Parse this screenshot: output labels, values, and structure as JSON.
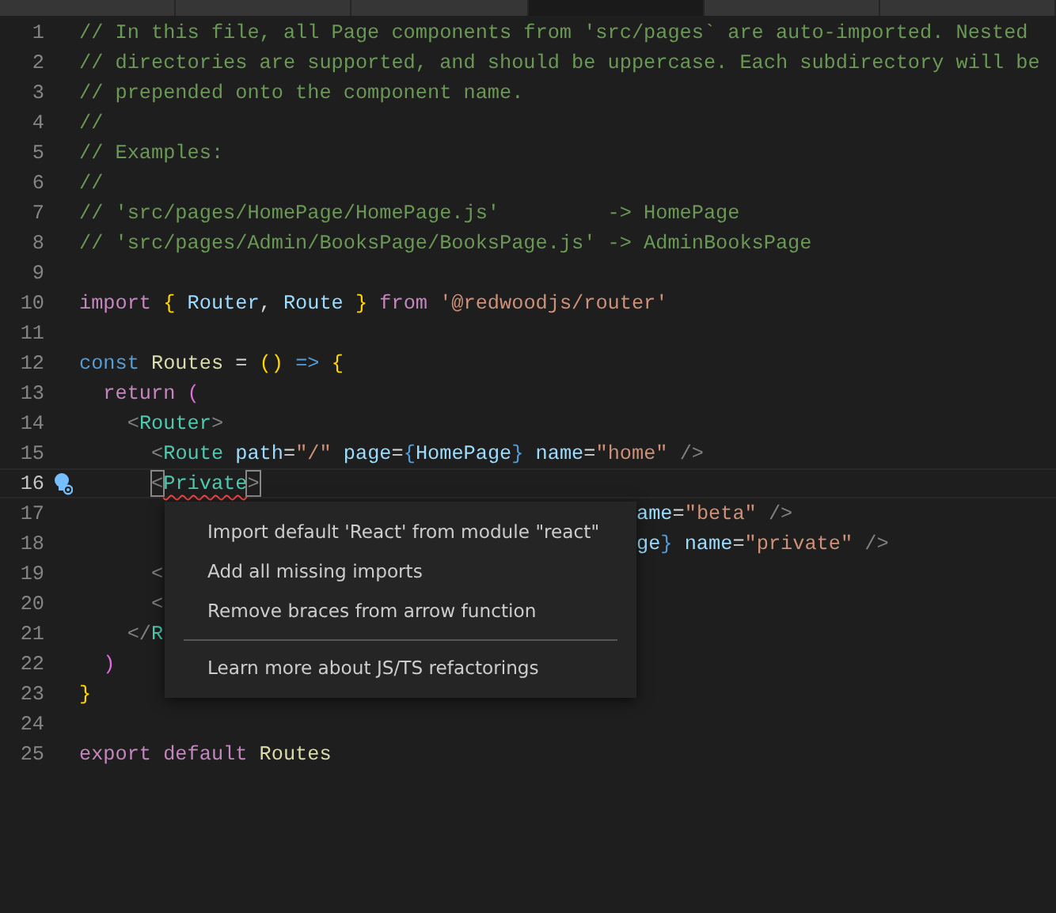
{
  "tabs": [
    {
      "selected": false
    },
    {
      "selected": false
    },
    {
      "selected": false
    },
    {
      "selected": true
    },
    {
      "selected": false
    },
    {
      "selected": false
    }
  ],
  "lines": [
    {
      "number": "1",
      "current": false,
      "tokens": [
        {
          "kind": "comment",
          "text": "// In this file, all Page components from 'src/pages` are auto-imported. Nested"
        }
      ]
    },
    {
      "number": "2",
      "current": false,
      "tokens": [
        {
          "kind": "comment",
          "text": "// directories are supported, and should be uppercase. Each subdirectory will be"
        }
      ]
    },
    {
      "number": "3",
      "current": false,
      "tokens": [
        {
          "kind": "comment",
          "text": "// prepended onto the component name."
        }
      ]
    },
    {
      "number": "4",
      "current": false,
      "tokens": [
        {
          "kind": "comment",
          "text": "//"
        }
      ]
    },
    {
      "number": "5",
      "current": false,
      "tokens": [
        {
          "kind": "comment",
          "text": "// Examples:"
        }
      ]
    },
    {
      "number": "6",
      "current": false,
      "tokens": [
        {
          "kind": "comment",
          "text": "//"
        }
      ]
    },
    {
      "number": "7",
      "current": false,
      "tokens": [
        {
          "kind": "comment",
          "text": "// 'src/pages/HomePage/HomePage.js'         -> HomePage"
        }
      ]
    },
    {
      "number": "8",
      "current": false,
      "tokens": [
        {
          "kind": "comment",
          "text": "// 'src/pages/Admin/BooksPage/BooksPage.js' -> AdminBooksPage"
        }
      ]
    },
    {
      "number": "9",
      "current": false
    },
    {
      "number": "10",
      "current": false,
      "tokens": [
        {
          "kind": "keyword",
          "text": "import "
        },
        {
          "kind": "brace",
          "text": "{ "
        },
        {
          "kind": "var",
          "text": "Router"
        },
        {
          "kind": "text",
          "text": ", "
        },
        {
          "kind": "var",
          "text": "Route "
        },
        {
          "kind": "brace",
          "text": "} "
        },
        {
          "kind": "keyword",
          "text": "from "
        },
        {
          "kind": "string",
          "text": "'@redwoodjs/router'"
        }
      ]
    },
    {
      "number": "11",
      "current": false
    },
    {
      "number": "12",
      "current": false,
      "tokens": [
        {
          "kind": "storage",
          "text": "const "
        },
        {
          "kind": "func",
          "text": "Routes "
        },
        {
          "kind": "text",
          "text": "= "
        },
        {
          "kind": "brace",
          "text": "() "
        },
        {
          "kind": "storage",
          "text": "=> "
        },
        {
          "kind": "brace",
          "text": "{"
        }
      ]
    },
    {
      "number": "13",
      "current": false,
      "tokens": [
        {
          "kind": "keyword",
          "text": "  return "
        },
        {
          "kind": "paren",
          "text": "("
        }
      ]
    },
    {
      "number": "14",
      "current": false,
      "tokens": [
        {
          "kind": "punct",
          "text": "    <"
        },
        {
          "kind": "tag",
          "text": "Router"
        },
        {
          "kind": "punct",
          "text": ">"
        }
      ]
    },
    {
      "number": "15",
      "current": false,
      "tokens": [
        {
          "kind": "punct",
          "text": "      <"
        },
        {
          "kind": "tag",
          "text": "Route "
        },
        {
          "kind": "var",
          "text": "path"
        },
        {
          "kind": "text",
          "text": "="
        },
        {
          "kind": "string",
          "text": "\"/\" "
        },
        {
          "kind": "var",
          "text": "page"
        },
        {
          "kind": "text",
          "text": "="
        },
        {
          "kind": "storage",
          "text": "{"
        },
        {
          "kind": "var",
          "text": "HomePage"
        },
        {
          "kind": "storage",
          "text": "} "
        },
        {
          "kind": "var",
          "text": "name"
        },
        {
          "kind": "text",
          "text": "="
        },
        {
          "kind": "string",
          "text": "\"home\" "
        },
        {
          "kind": "punct",
          "text": "/>"
        }
      ]
    },
    {
      "number": "16",
      "current": true,
      "lightbulb": true,
      "tokens": [
        {
          "kind": "punct",
          "text": "      <",
          "matched": true
        },
        {
          "kind": "tag",
          "text": "Private",
          "error": true
        },
        {
          "kind": "punct",
          "text": ">",
          "matched": true
        }
      ]
    },
    {
      "number": "17",
      "current": false,
      "after": [
        {
          "kind": "var",
          "text": "ame"
        },
        {
          "kind": "text",
          "text": "="
        },
        {
          "kind": "string",
          "text": "\"beta\" "
        },
        {
          "kind": "punct",
          "text": "/>"
        }
      ]
    },
    {
      "number": "18",
      "current": false,
      "after": [
        {
          "kind": "var",
          "text": "ge"
        },
        {
          "kind": "storage",
          "text": "} "
        },
        {
          "kind": "var",
          "text": "name"
        },
        {
          "kind": "text",
          "text": "="
        },
        {
          "kind": "string",
          "text": "\"private\" "
        },
        {
          "kind": "punct",
          "text": "/>"
        }
      ]
    },
    {
      "number": "19",
      "current": false,
      "tokens": [
        {
          "kind": "punct",
          "text": "      <"
        }
      ]
    },
    {
      "number": "20",
      "current": false,
      "tokens": [
        {
          "kind": "punct",
          "text": "      <"
        }
      ]
    },
    {
      "number": "21",
      "current": false,
      "tokens": [
        {
          "kind": "punct",
          "text": "    </"
        },
        {
          "kind": "tag",
          "text": "R"
        }
      ]
    },
    {
      "number": "22",
      "current": false,
      "tokens": [
        {
          "kind": "paren",
          "text": "  )"
        }
      ]
    },
    {
      "number": "23",
      "current": false,
      "tokens": [
        {
          "kind": "brace",
          "text": "}"
        }
      ]
    },
    {
      "number": "24",
      "current": false
    },
    {
      "number": "25",
      "current": false,
      "tokens": [
        {
          "kind": "keyword",
          "text": "export default "
        },
        {
          "kind": "func",
          "text": "Routes"
        }
      ]
    }
  ],
  "quick_fix_menu": [
    {
      "kind": "item",
      "label": "Import default 'React' from module \"react\""
    },
    {
      "kind": "item",
      "label": "Add all missing imports"
    },
    {
      "kind": "item",
      "label": "Remove braces from arrow function"
    },
    {
      "kind": "separator"
    },
    {
      "kind": "item",
      "label": "Learn more about JS/TS refactorings"
    }
  ]
}
